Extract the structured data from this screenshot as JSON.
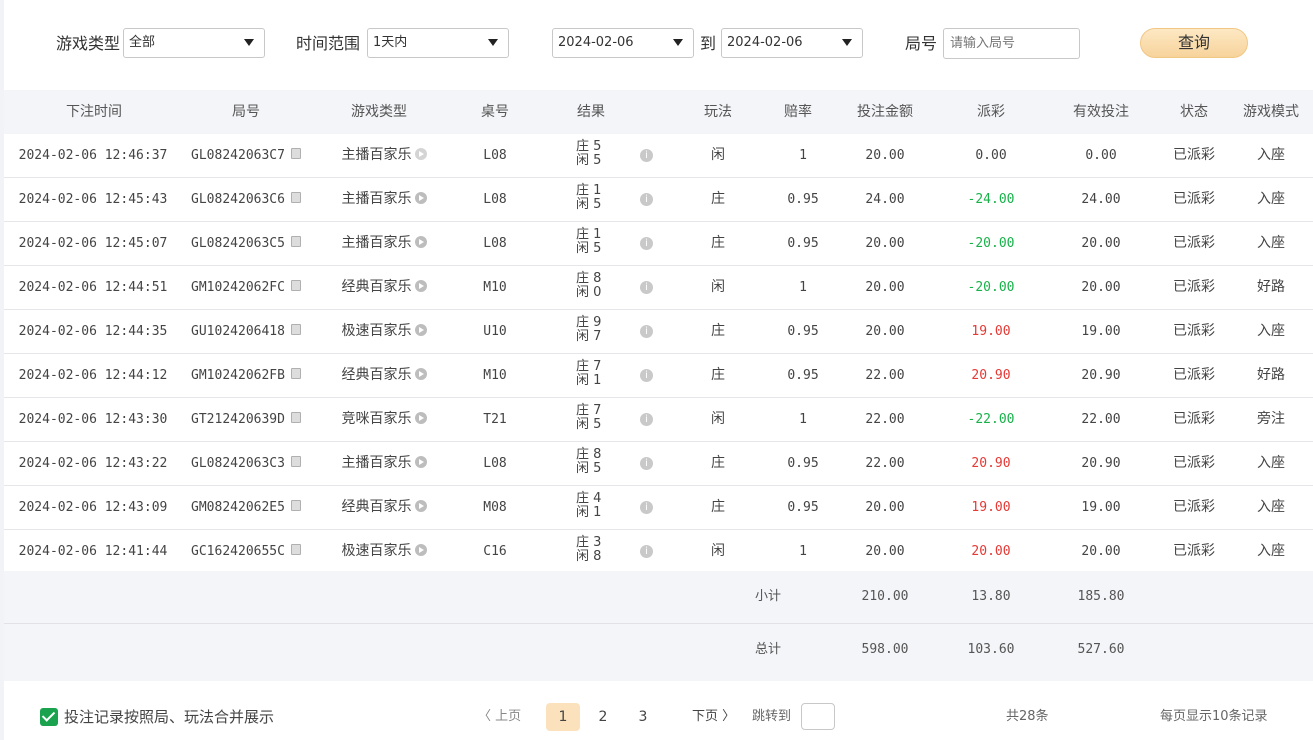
{
  "filters": {
    "game_type_label": "游戏类型",
    "game_type_value": "全部",
    "time_range_label": "时间范围",
    "time_range_value": "1天内",
    "date_from": "2024-02-06",
    "to_label": "到",
    "date_to": "2024-02-06",
    "round_label": "局号",
    "round_placeholder": "请输入局号",
    "query_button": "查询"
  },
  "table": {
    "headers": [
      "下注时间",
      "局号",
      "游戏类型",
      "桌号",
      "结果",
      "玩法",
      "赔率",
      "投注金额",
      "派彩",
      "有效投注",
      "状态",
      "游戏模式"
    ],
    "banker_label": "庄",
    "player_label": "闲",
    "rows": [
      {
        "time": "2024-02-06 12:46:37",
        "round": "GL08242063C7",
        "game": "主播百家乐",
        "table": "L08",
        "banker": "5",
        "player": "5",
        "play": "闲",
        "odds": "1",
        "bet": "20.00",
        "payout": "0.00",
        "payout_color": "neutral",
        "valid": "0.00",
        "status": "已派彩",
        "mode": "入座"
      },
      {
        "time": "2024-02-06 12:45:43",
        "round": "GL08242063C6",
        "game": "主播百家乐",
        "table": "L08",
        "banker": "1",
        "player": "5",
        "play": "庄",
        "odds": "0.95",
        "bet": "24.00",
        "payout": "-24.00",
        "payout_color": "green",
        "valid": "24.00",
        "status": "已派彩",
        "mode": "入座"
      },
      {
        "time": "2024-02-06 12:45:07",
        "round": "GL08242063C5",
        "game": "主播百家乐",
        "table": "L08",
        "banker": "1",
        "player": "5",
        "play": "庄",
        "odds": "0.95",
        "bet": "20.00",
        "payout": "-20.00",
        "payout_color": "green",
        "valid": "20.00",
        "status": "已派彩",
        "mode": "入座"
      },
      {
        "time": "2024-02-06 12:44:51",
        "round": "GM10242062FC",
        "game": "经典百家乐",
        "table": "M10",
        "banker": "8",
        "player": "0",
        "play": "闲",
        "odds": "1",
        "bet": "20.00",
        "payout": "-20.00",
        "payout_color": "green",
        "valid": "20.00",
        "status": "已派彩",
        "mode": "好路"
      },
      {
        "time": "2024-02-06 12:44:35",
        "round": "GU1024206418",
        "game": "极速百家乐",
        "table": "U10",
        "banker": "9",
        "player": "7",
        "play": "庄",
        "odds": "0.95",
        "bet": "20.00",
        "payout": "19.00",
        "payout_color": "red",
        "valid": "19.00",
        "status": "已派彩",
        "mode": "入座"
      },
      {
        "time": "2024-02-06 12:44:12",
        "round": "GM10242062FB",
        "game": "经典百家乐",
        "table": "M10",
        "banker": "7",
        "player": "1",
        "play": "庄",
        "odds": "0.95",
        "bet": "22.00",
        "payout": "20.90",
        "payout_color": "red",
        "valid": "20.90",
        "status": "已派彩",
        "mode": "好路"
      },
      {
        "time": "2024-02-06 12:43:30",
        "round": "GT212420639D",
        "game": "竞咪百家乐",
        "table": "T21",
        "banker": "7",
        "player": "5",
        "play": "闲",
        "odds": "1",
        "bet": "22.00",
        "payout": "-22.00",
        "payout_color": "green",
        "valid": "22.00",
        "status": "已派彩",
        "mode": "旁注"
      },
      {
        "time": "2024-02-06 12:43:22",
        "round": "GL08242063C3",
        "game": "主播百家乐",
        "table": "L08",
        "banker": "8",
        "player": "5",
        "play": "庄",
        "odds": "0.95",
        "bet": "22.00",
        "payout": "20.90",
        "payout_color": "red",
        "valid": "20.90",
        "status": "已派彩",
        "mode": "入座"
      },
      {
        "time": "2024-02-06 12:43:09",
        "round": "GM08242062E5",
        "game": "经典百家乐",
        "table": "M08",
        "banker": "4",
        "player": "1",
        "play": "庄",
        "odds": "0.95",
        "bet": "20.00",
        "payout": "19.00",
        "payout_color": "red",
        "valid": "19.00",
        "status": "已派彩",
        "mode": "入座"
      },
      {
        "time": "2024-02-06 12:41:44",
        "round": "GC162420655C",
        "game": "极速百家乐",
        "table": "C16",
        "banker": "3",
        "player": "8",
        "play": "闲",
        "odds": "1",
        "bet": "20.00",
        "payout": "20.00",
        "payout_color": "red",
        "valid": "20.00",
        "status": "已派彩",
        "mode": "入座"
      }
    ]
  },
  "summary": {
    "subtotal_label": "小计",
    "subtotal_bet": "210.00",
    "subtotal_payout": "13.80",
    "subtotal_valid": "185.80",
    "total_label": "总计",
    "total_bet": "598.00",
    "total_payout": "103.60",
    "total_valid": "527.60"
  },
  "footer": {
    "merge_checkbox_label": "投注记录按照局、玩法合并展示",
    "merge_checked": true,
    "prev_label": "〈 上页",
    "pages": [
      "1",
      "2",
      "3"
    ],
    "current_page": "1",
    "next_label": "下页 〉",
    "jump_label": "跳转到",
    "total_text": "共28条",
    "per_page_text": "每页显示10条记录"
  },
  "colors": {
    "win": "#e53935",
    "loss": "#19b14a",
    "accent": "#f7d39b",
    "checkbox": "#1aa24f"
  }
}
